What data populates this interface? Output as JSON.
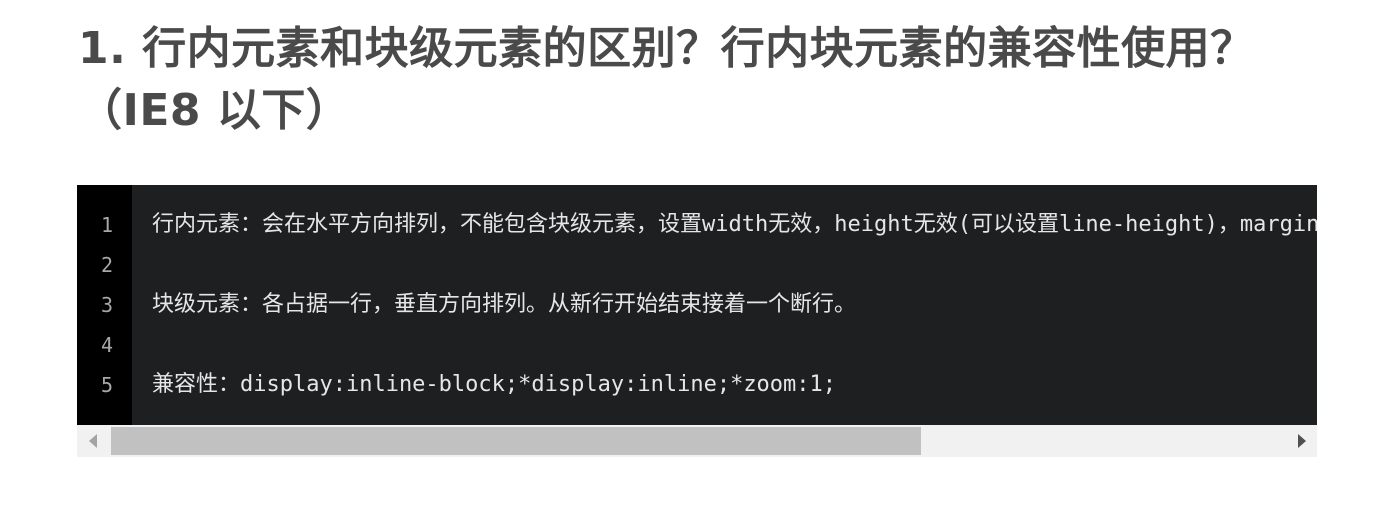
{
  "heading": {
    "line1": "1. 行内元素和块级元素的区别？行内块元素的兼容性使用？",
    "line2": "（IE8 以下）"
  },
  "code": {
    "line_numbers": [
      "1",
      "2",
      "3",
      "4",
      "5"
    ],
    "lines": [
      "行内元素：会在水平方向排列，不能包含块级元素，设置width无效，height无效(可以设置line-height)，margin上下无效，padding上下无效",
      "",
      "块级元素：各占据一行，垂直方向排列。从新行开始结束接着一个断行。",
      "",
      "兼容性：display:inline-block;*display:inline;*zoom:1;"
    ]
  },
  "scrollbar": {
    "left_icon": "triangle-left-icon",
    "right_icon": "triangle-right-icon",
    "thumb_fraction": 0.67,
    "position_fraction": 0.0
  },
  "colors": {
    "heading_text": "#4a4a4a",
    "code_background": "#1d1f21",
    "gutter_background": "#000000",
    "code_text": "#e6e6e6",
    "line_number_text": "#a8a8a8",
    "scrollbar_track": "#f1f1f1",
    "scrollbar_thumb": "#c1c1c1"
  }
}
